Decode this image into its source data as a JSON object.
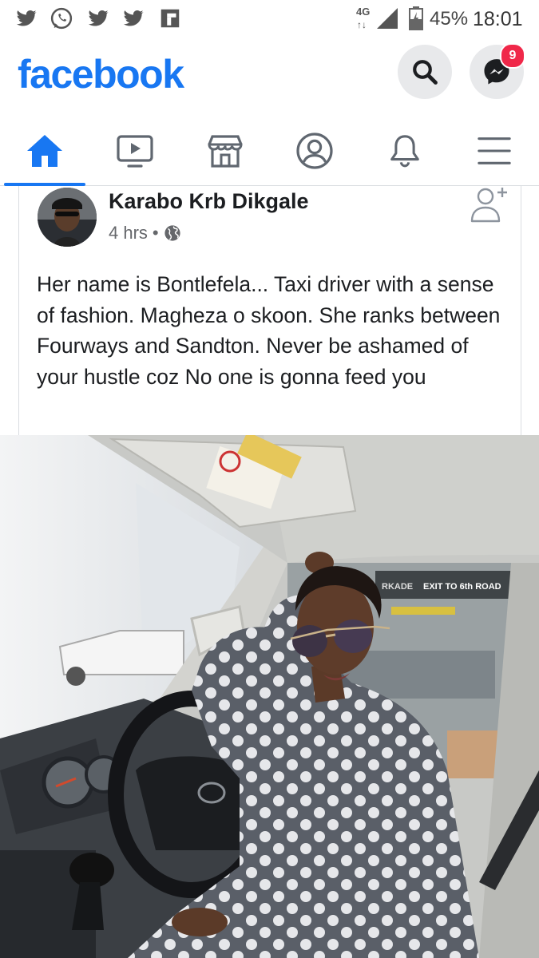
{
  "status_bar": {
    "notification_icons": [
      "twitter-icon",
      "whatsapp-icon",
      "twitter-icon",
      "twitter-icon",
      "flipboard-icon"
    ],
    "network": "4G",
    "battery": "45%",
    "time": "18:01"
  },
  "header": {
    "logo": "facebook",
    "brand_color": "#1877f2",
    "messenger_badge": "9"
  },
  "nav": {
    "tabs": [
      {
        "name": "home",
        "icon": "home-icon",
        "active": true
      },
      {
        "name": "watch",
        "icon": "video-icon",
        "active": false
      },
      {
        "name": "marketplace",
        "icon": "store-icon",
        "active": false
      },
      {
        "name": "profile",
        "icon": "profile-icon",
        "active": false
      },
      {
        "name": "notifications",
        "icon": "bell-icon",
        "active": false
      },
      {
        "name": "menu",
        "icon": "menu-icon",
        "active": false
      }
    ]
  },
  "post": {
    "author": "Karabo Krb Dikgale",
    "time": "4 hrs",
    "separator": "•",
    "privacy_icon": "globe-icon",
    "text": "Her name is Bontlefela... Taxi driver with a sense of fashion. Magheza o skoon. She ranks between Fourways and Sandton. Never be ashamed of your hustle coz No one is gonna feed you",
    "photo": {
      "sign_text": "EXIT TO 6th ROAD",
      "sign_prefix": "RKADE"
    }
  }
}
